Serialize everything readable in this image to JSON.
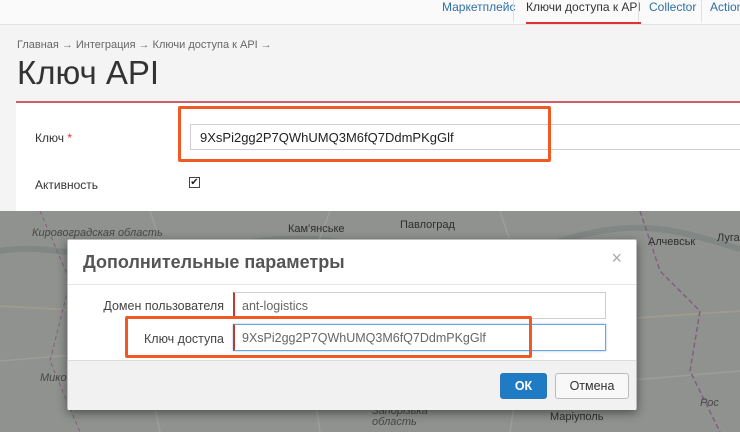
{
  "top_nav": {
    "tabs": [
      {
        "label": "Маркетплейс",
        "active": false
      },
      {
        "label": "Ключи доступа к API",
        "active": true
      },
      {
        "label": "Collector",
        "active": false
      },
      {
        "label": "Action",
        "active": false
      }
    ]
  },
  "breadcrumb": {
    "items": [
      "Главная",
      "Интеграция",
      "Ключи доступа к API"
    ],
    "separator": "→"
  },
  "page": {
    "title": "Ключ API"
  },
  "form": {
    "key_label": "Ключ",
    "required_mark": "*",
    "key_value": "9XsPi2gg2P7QWhUMQ3M6fQ7DdmPKgGlf",
    "active_label": "Активность",
    "active_checked": true
  },
  "map": {
    "labels": [
      "Кировоградская область",
      "Кам'янське",
      "Павлоград",
      "Алчевськ",
      "Луга",
      "Мико",
      "Запорізька область",
      "Маріуполь",
      "Рос"
    ]
  },
  "modal": {
    "title": "Дополнительные параметры",
    "close_glyph": "×",
    "domain_label": "Домен пользователя",
    "domain_value": "ant-logistics",
    "access_key_label": "Ключ доступа",
    "access_key_value": "9XsPi2gg2P7QWhUMQ3M6fQ7DdmPKgGlf",
    "ok_label": "ОК",
    "cancel_label": "Отмена"
  },
  "colors": {
    "accent_red": "#d05c68",
    "highlight_orange": "#ef5a24",
    "primary_blue": "#1f7bc4",
    "link_blue": "#2f6fa6"
  }
}
